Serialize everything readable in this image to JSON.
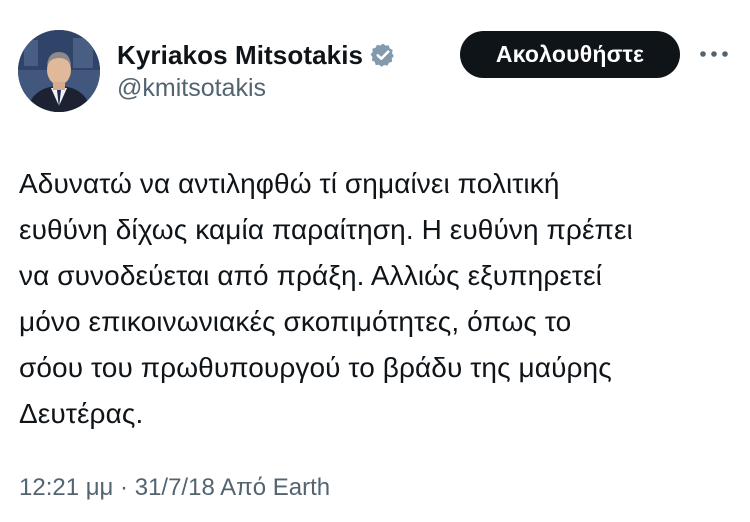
{
  "author": {
    "display_name": "Kyriakos Mitsotakis",
    "handle": "@kmitsotakis",
    "verified": true,
    "avatar_icon": "profile-photo"
  },
  "follow_button": {
    "label": "Ακολουθήστε"
  },
  "more_icon": "more-horizontal-icon",
  "tweet": {
    "text": "Αδυνατώ να αντιληφθώ τί σημαίνει πολιτική\nευθύνη δίχως καμία παραίτηση. Η ευθύνη πρέπει\nνα συνοδεύεται από πράξη. Αλλιώς εξυπηρετεί\nμόνο επικοινωνιακές σκοπιμότητες, όπως το\nσόου του πρωθυπουργού το βράδυ της μαύρης\nΔευτέρας."
  },
  "meta": {
    "time": "12:21 μμ",
    "separator": " · ",
    "date": "31/7/18",
    "source": " Από Earth"
  },
  "colors": {
    "text": "#0f1419",
    "secondary": "#536471",
    "button_bg": "#0f1419",
    "button_text": "#ffffff",
    "verified_badge": "#829aab"
  }
}
